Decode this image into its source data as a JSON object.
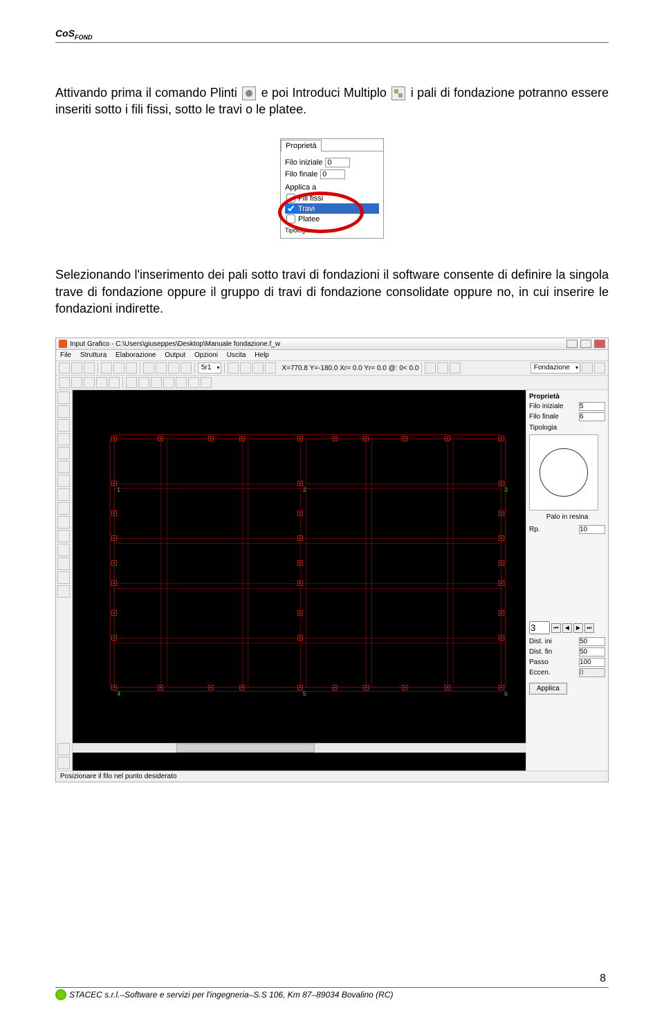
{
  "header": {
    "title_main": "CoS",
    "title_sub": "FOND"
  },
  "paragraphs": {
    "p1a": "Attivando prima il comando Plinti ",
    "p1b": " e poi Introduci Multiplo ",
    "p1c": " i pali di fondazione potranno essere inseriti sotto i fili fissi, sotto le travi o le platee.",
    "p2": "Selezionando l'inserimento dei pali sotto travi di fondazioni il software consente di definire la singola trave di fondazione oppure il gruppo di travi di fondazione consolidate oppure no, in cui inserire le fondazioni indirette."
  },
  "prop_panel": {
    "tab": "Proprietà",
    "filo_iniziale_label": "Filo iniziale",
    "filo_iniziale_val": "0",
    "filo_finale_label": "Filo finale",
    "filo_finale_val": "0",
    "applica_label": "Applica a",
    "chk1": "Fili fissi",
    "chk2": "Travi",
    "chk3": "Platee",
    "tipologia": "Tipologia"
  },
  "app": {
    "title": "Input Grafico - C:\\Users\\giuseppes\\Desktop\\Manuale fondazione.f_w",
    "menus": [
      "File",
      "Struttura",
      "Elaborazione",
      "Output",
      "Opzioni",
      "Uscita",
      "Help"
    ],
    "coord": "X=770.8 Y=-180.0 Xr= 0.0 Yr= 0.0 @: 0< 0.0",
    "section_combo": "5r1",
    "fond_combo": "Fondazione",
    "status": "Posizionare il filo nel punto desiderato",
    "right": {
      "proprieta": "Proprietà",
      "filo_ini_l": "Filo iniziale",
      "filo_ini_v": "5",
      "filo_fin_l": "Filo finale",
      "filo_fin_v": "6",
      "tipologia": "Tipologia",
      "palo_label": "Palo in resina",
      "rp_l": "Rp.",
      "rp_v": "10",
      "num_v": "3",
      "dist_ini_l": "Dist. ini",
      "dist_ini_v": "50",
      "dist_fin_l": "Dist. fin",
      "dist_fin_v": "50",
      "passo_l": "Passo",
      "passo_v": "100",
      "eccen_l": "Eccen.",
      "eccen_v": "0",
      "applica": "Applica"
    },
    "grid_labels": {
      "n1": "1",
      "n2": "2",
      "n3": "3",
      "n4": "4",
      "n5": "5",
      "n6": "6"
    }
  },
  "footer": {
    "text": "STACEC s.r.l.–Software e servizi per l'ingegneria–S.S 106, Km 87–89034 Bovalino (RC)",
    "page": "8"
  }
}
